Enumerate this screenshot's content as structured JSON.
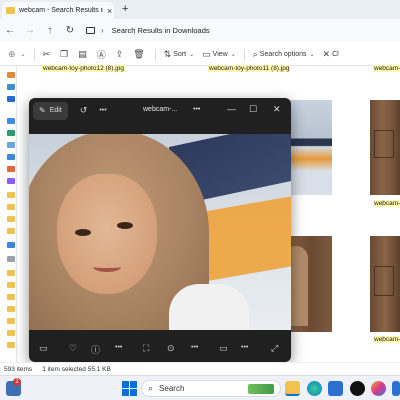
{
  "tab": {
    "title": "webcam - Search Results in Do",
    "close": "×",
    "new_tab": "+"
  },
  "address": {
    "location": "Search Results in Downloads",
    "separator": "›"
  },
  "toolbar": {
    "new_label": "",
    "sort_label": "Sort",
    "view_label": "View",
    "search_options_label": "Search options",
    "close_label": "Cl"
  },
  "files": {
    "caption_left": "webcam-toy-photo12 (8).jpg",
    "caption_right": "webcam-toy-photo11 (8).jpg",
    "caption_edge_top": "webcam-",
    "caption_edge_mid": "webcam-",
    "caption_edge_bottom": "webcam-"
  },
  "viewer": {
    "edit_label": "Edit",
    "title": "webcam-...",
    "more": "•••",
    "minimize": "—",
    "maximize": "☐",
    "close": "✕"
  },
  "status": {
    "item_count": "593 items",
    "selection": "1 item selected  55,1 KB"
  },
  "taskbar": {
    "search_placeholder": "Search",
    "notification_badge": "2"
  },
  "colors": {
    "accent": "#0067c0",
    "selection_caption": "#fff9b0",
    "viewer_bg": "#202020"
  }
}
